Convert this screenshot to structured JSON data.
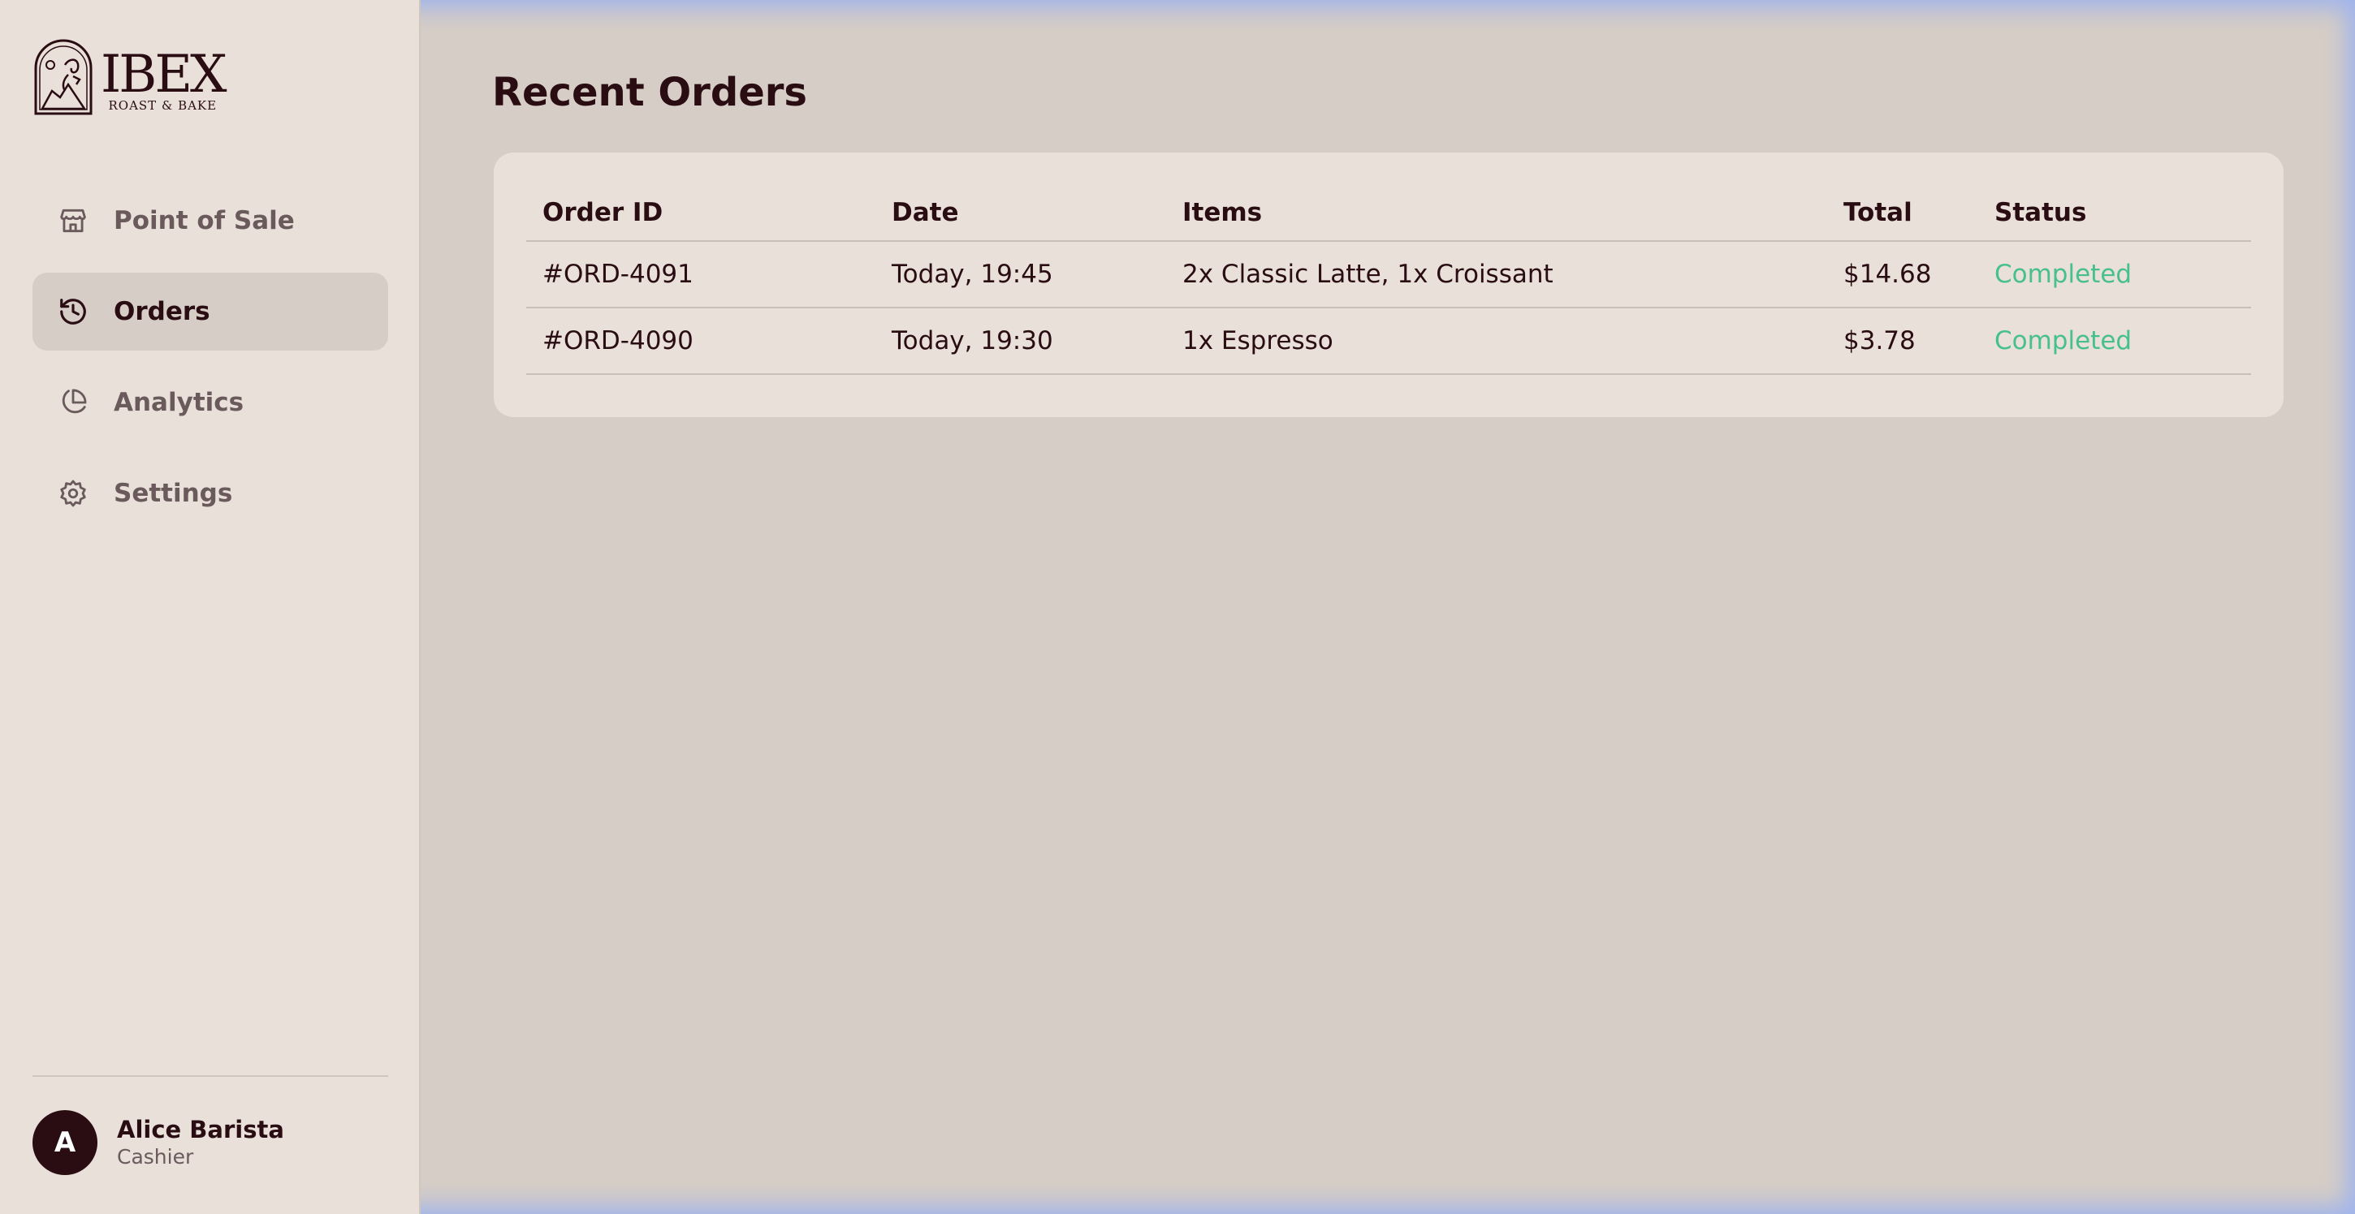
{
  "brand": {
    "title": "IBEX",
    "subtitle": "ROAST & BAKE"
  },
  "sidebar": {
    "items": [
      {
        "label": "Point of Sale",
        "icon": "store-icon",
        "active": false
      },
      {
        "label": "Orders",
        "icon": "history-icon",
        "active": true
      },
      {
        "label": "Analytics",
        "icon": "pie-chart-icon",
        "active": false
      },
      {
        "label": "Settings",
        "icon": "gear-icon",
        "active": false
      }
    ]
  },
  "user": {
    "initial": "A",
    "name": "Alice Barista",
    "role": "Cashier"
  },
  "main": {
    "title": "Recent Orders",
    "table": {
      "columns": [
        "Order ID",
        "Date",
        "Items",
        "Total",
        "Status"
      ],
      "rows": [
        {
          "id": "#ORD-4091",
          "date": "Today, 19:45",
          "items": "2x Classic Latte, 1x Croissant",
          "total": "$14.68",
          "status": "Completed"
        },
        {
          "id": "#ORD-4090",
          "date": "Today, 19:30",
          "items": "1x Espresso",
          "total": "$3.78",
          "status": "Completed"
        }
      ]
    }
  },
  "colors": {
    "primary": "#2a0d12",
    "muted": "#6b5a5c",
    "status_completed": "#47c08b",
    "sidebar_bg": "#e8e0d9",
    "main_bg": "#d6cdc6"
  }
}
